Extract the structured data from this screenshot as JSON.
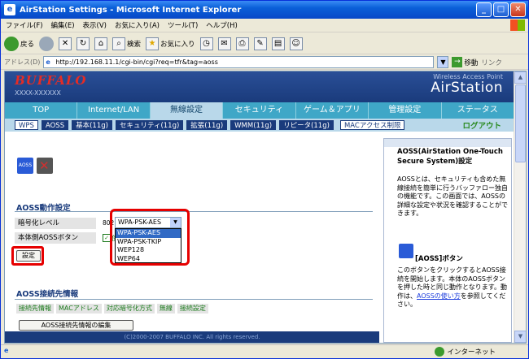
{
  "window": {
    "title": "AirStation Settings - Microsoft Internet Explorer"
  },
  "menubar": {
    "items": [
      "ファイル(F)",
      "編集(E)",
      "表示(V)",
      "お気に入り(A)",
      "ツール(T)",
      "ヘルプ(H)"
    ]
  },
  "toolbar": {
    "back": "戻る",
    "search": "検索",
    "favorites": "お気に入り"
  },
  "address": {
    "label": "アドレス(D)",
    "url": "http://192.168.11.1/cgi-bin/cgi?req=tfr&tag=aoss",
    "go": "移動",
    "links": "リンク"
  },
  "header": {
    "logo": "BUFFALO",
    "model": "XXXX-XXXXXX",
    "wap": "Wireless Access Point",
    "brand": "AirStation"
  },
  "nav": {
    "tabs": [
      "TOP",
      "Internet/LAN",
      "無線設定",
      "セキュリティ",
      "ゲーム＆アプリ",
      "管理設定",
      "ステータス"
    ]
  },
  "subnav": {
    "items": [
      "WPS",
      "AOSS",
      "基本(11g)",
      "セキュリティ(11g)",
      "拡張(11g)",
      "WMM(11g)",
      "リピータ(11g)"
    ],
    "mac": "MACアクセス制限",
    "logout": "ログアウト"
  },
  "main": {
    "icon_label": "AOSS",
    "section1": "AOSS動作設定",
    "rows": [
      "暗号化レベル",
      "本体側AOSSボタン"
    ],
    "proto": "802.11g",
    "selected": "WPA-PSK-AES",
    "options": [
      "WPA-PSK-AES",
      "WPA-PSK-TKIP",
      "WEP128",
      "WEP64"
    ],
    "check_label": "使用",
    "set_btn": "設定",
    "section2": "AOSS接続先情報",
    "cols": [
      "接続先情報",
      "MACアドレス",
      "対応暗号化方式",
      "無線",
      "接続設定"
    ],
    "edit_btn": "AOSS接続先情報の編集",
    "footer": "(C)2000-2007 BUFFALO INC. All rights reserved."
  },
  "side": {
    "title": "AOSS(AirStation One-Touch Secure System)設定",
    "desc": "AOSSとは、セキュリティも含めた無線接続を簡単に行うバッファロー独自の機能です。この画面では、AOSSの詳細な設定や状況を確認することができます。",
    "btn_title": "[AOSS]ボタン",
    "desc2_a": "このボタンをクリックするとAOSS接続を開始します。本体のAOSSボタンを押した時と同じ動作となります。動作は、",
    "desc2_link": "AOSSの使い方",
    "desc2_b": "を参照してください。"
  },
  "status": {
    "zone": "インターネット"
  }
}
